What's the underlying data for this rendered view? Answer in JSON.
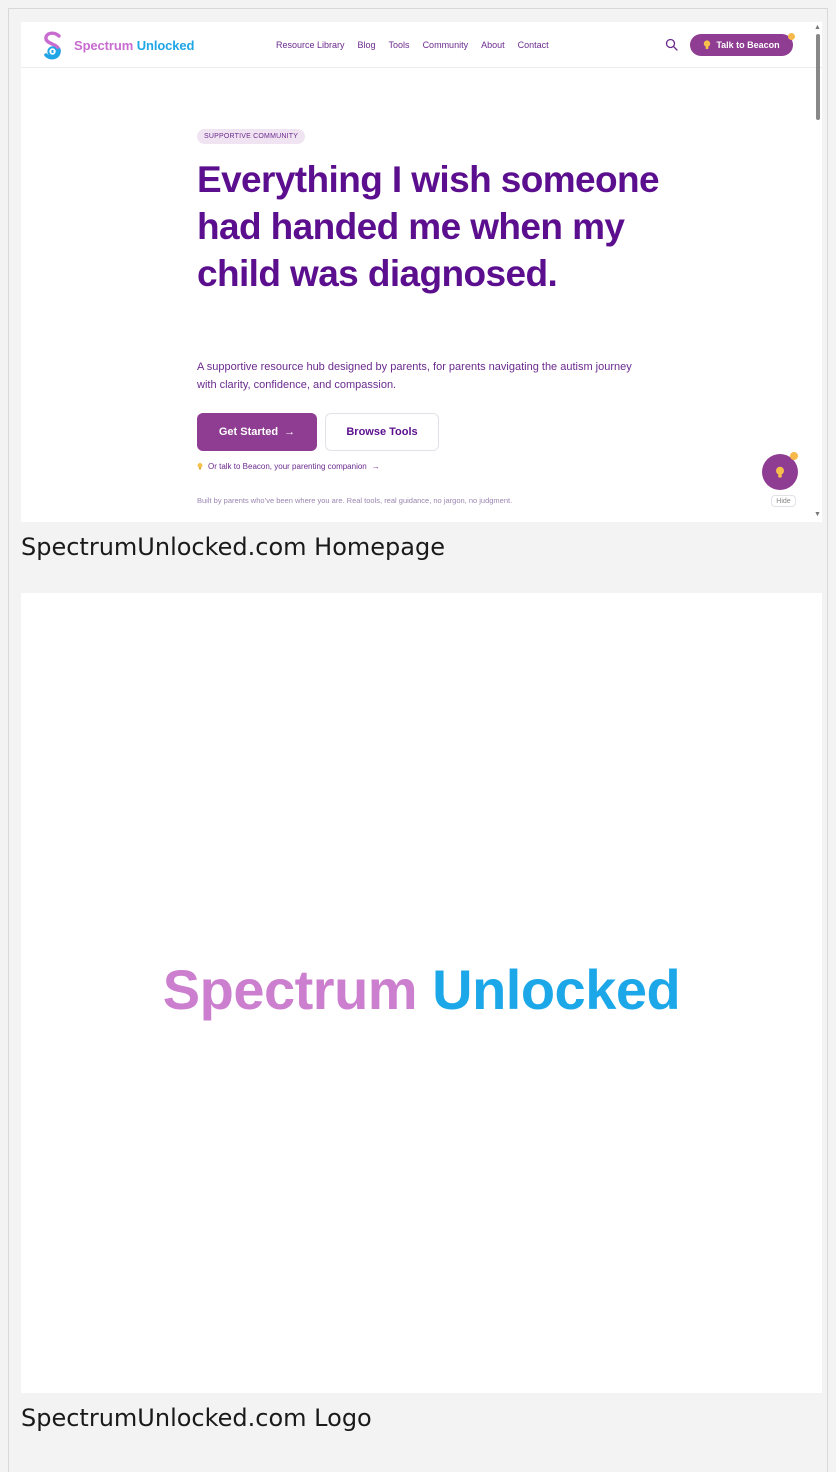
{
  "colors": {
    "brand_pink": "#c86cd0",
    "brand_blue": "#1fa6e6",
    "primary_purple": "#8e3d92",
    "heading_purple": "#5b0f8e",
    "accent_yellow": "#f6b94a"
  },
  "homepage": {
    "logo": {
      "part1": "Spectrum",
      "part2": "Unlocked"
    },
    "nav": [
      "Resource Library",
      "Blog",
      "Tools",
      "Community",
      "About",
      "Contact"
    ],
    "search_icon": "search-icon",
    "talk_button": "Talk to Beacon",
    "badge": "SUPPORTIVE COMMUNITY",
    "headline": "Everything I wish someone had handed me when my child was diagnosed.",
    "subheadline": "A supportive resource hub designed by parents, for parents navigating the autism journey with clarity, confidence, and compassion.",
    "cta_primary": "Get Started",
    "cta_secondary": "Browse Tools",
    "talk_link": "Or talk to Beacon, your parenting companion",
    "footnote": "Built by parents who’ve been where you are. Real tools, real guidance, no jargon, no judgment.",
    "hide_label": "Hide"
  },
  "captions": {
    "homepage": "SpectrumUnlocked.com Homepage",
    "logo": "SpectrumUnlocked.com Logo"
  },
  "logo_panel": {
    "part1": "Spectrum",
    "part2": "Unlocked"
  }
}
